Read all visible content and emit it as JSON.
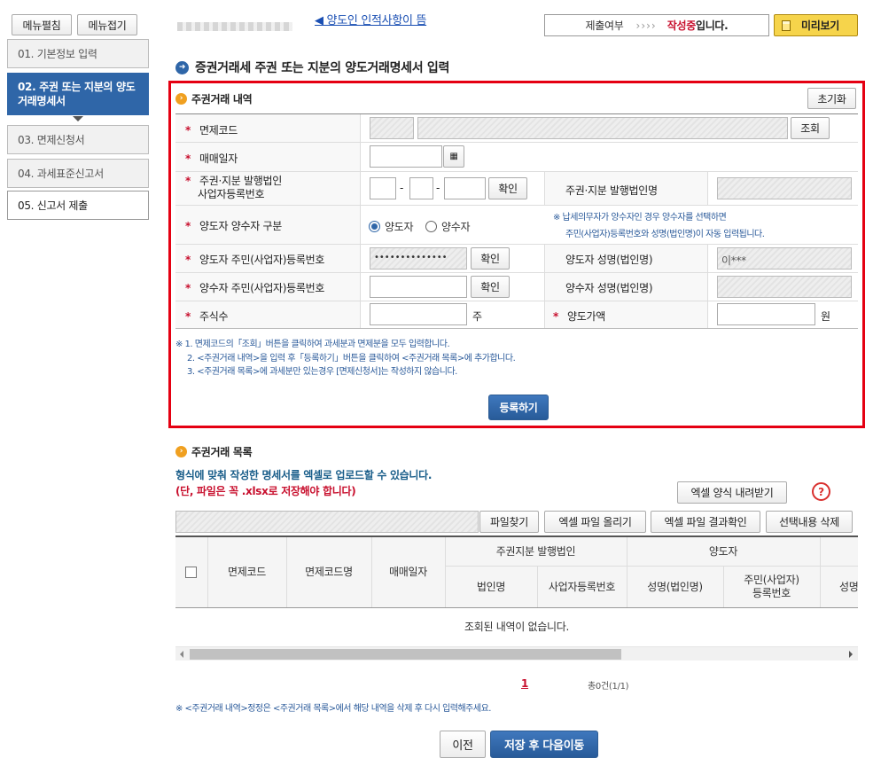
{
  "sidebar": {
    "expand_label": "메뉴펼침",
    "collapse_label": "메뉴접기",
    "items": [
      {
        "label": "01. 기본정보 입력"
      },
      {
        "label": "02. 주권 또는 지분의 양도거래명세서"
      },
      {
        "label": "03. 면제신청서"
      },
      {
        "label": "04. 과세표준신고서"
      },
      {
        "label": "05. 신고서 제출"
      }
    ]
  },
  "topbar": {
    "taxpayer_link": "◀ 양도인 인적사항이 뜸",
    "submit_label": "제출여부",
    "arrows": "››››",
    "status_highlight": "작성중",
    "status_suffix": "입니다.",
    "preview_label": "미리보기"
  },
  "page_title": "증권거래세 주권 또는 지분의 양도거래명세서 입력",
  "detail": {
    "title": "주권거래 내역",
    "reset_label": "초기화",
    "fields": {
      "exempt_code": {
        "label": "면제코드",
        "button": "조회"
      },
      "trade_date": {
        "label": "매매일자"
      },
      "issuer_bizno": {
        "label1": "주권·지분 발행법인",
        "label2": "사업자등록번호",
        "dash1": "-",
        "dash2": "-",
        "button": "확인"
      },
      "issuer_name": {
        "label": "주권·지분 발행법인명"
      },
      "party_type": {
        "label": "양도자 양수자 구분",
        "option1": "양도자",
        "option2": "양수자",
        "selected": "양도자"
      },
      "party_note": {
        "line1": "※ 납세의무자가 양수자인 경우 양수자를 선택하면",
        "line2": "주민(사업자)등록번호와 성명(법인명)이 자동 입력됩니다."
      },
      "seller_id": {
        "label": "양도자 주민(사업자)등록번호",
        "value": "••••••••••••••",
        "button": "확인"
      },
      "seller_name": {
        "label": "양도자 성명(법인명)",
        "value": "이***"
      },
      "buyer_id": {
        "label": "양수자 주민(사업자)등록번호",
        "button": "확인"
      },
      "buyer_name": {
        "label": "양수자 성명(법인명)"
      },
      "shares": {
        "label": "주식수",
        "unit": "주"
      },
      "price": {
        "label": "양도가액",
        "unit": "원"
      }
    },
    "notes": [
      "※ 1. 면제코드의「조회」버튼을 클릭하여 과세분과 면제분을 모두 입력합니다.",
      "2. <주권거래 내역>을 입력 후「등록하기」버튼을 클릭하여 <주권거래 목록>에 추가합니다.",
      "3. <주권거래 목록>에 과세분만 있는경우 [면제신청서]는 작성하지 않습니다."
    ],
    "register_label": "등록하기"
  },
  "list": {
    "title": "주권거래 목록",
    "upload_info": "형식에 맞춰 작성한 명세서를 엑셀로 업로드할 수 있습니다.",
    "xlsx_warning": "(단, 파일은 꼭 .xlsx로 저장해야 합니다)",
    "download_template": "엑셀 양식 내려받기",
    "help_icon": "?",
    "find_file": "파일찾기",
    "upload_excel": "엑셀 파일 올리기",
    "check_result": "엑셀 파일 결과확인",
    "delete_selected": "선택내용 삭제",
    "columns": {
      "exempt_code": "면제코드",
      "exempt_code_name": "면제코드명",
      "trade_date": "매매일자",
      "issuer_group": "주권지분 발행법인",
      "corp_name": "법인명",
      "biz_no": "사업자등록번호",
      "seller_group": "양도자",
      "seller_name": "성명(법인명)",
      "seller_id_1": "주민(사업자)",
      "seller_id_2": "등록번호",
      "next_col": "성명"
    },
    "empty_message": "조회된 내역이 없습니다.",
    "page_current": "1",
    "total": "총0건(1/1)",
    "footer_note": "※ <주권거래 내역>정정은 <주권거래 목록>에서 해당 내역을 삭제 후 다시 입력해주세요."
  },
  "nav": {
    "prev_label": "이전",
    "save_next_label": "저장 후 다음이동"
  },
  "colors": {
    "accent_blue": "#2f66a8",
    "highlight_red": "#e50012",
    "required_red": "#c8102e",
    "preview_yellow": "#f6d44b"
  }
}
